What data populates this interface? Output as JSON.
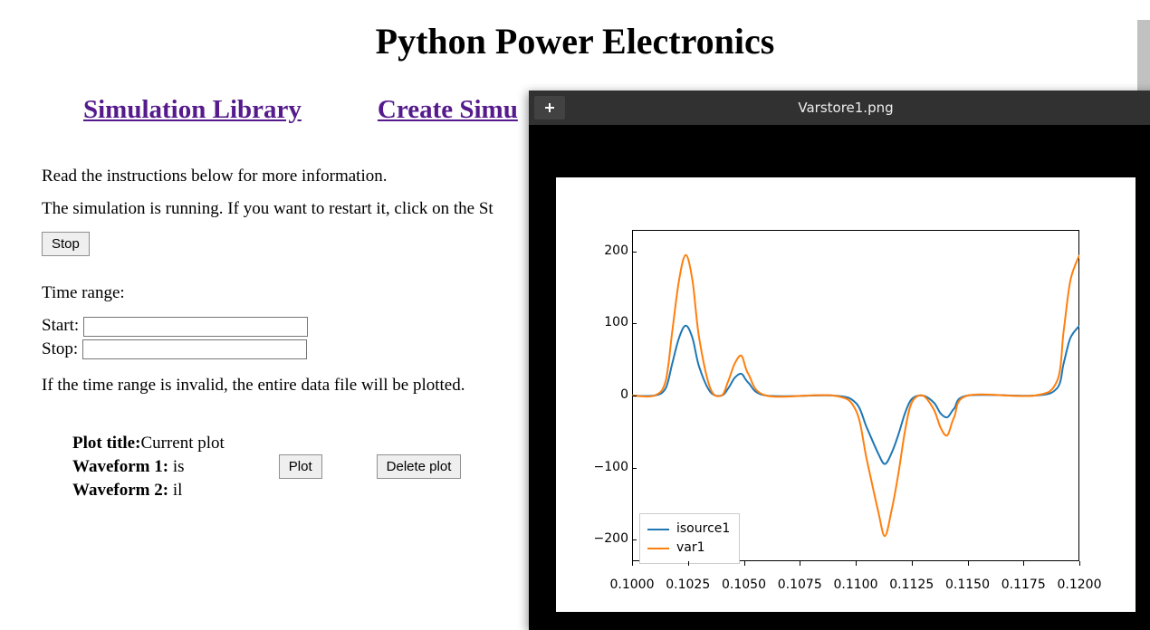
{
  "header": {
    "title": "Python Power Electronics"
  },
  "nav": {
    "link1": "Simulation Library",
    "link2": "Create Simu"
  },
  "instructions": {
    "line1": "Read the instructions below for more information.",
    "line2": "The simulation is running. If you want to restart it, click on the St"
  },
  "buttons": {
    "stop": "Stop",
    "plot": "Plot",
    "delete_plot": "Delete plot"
  },
  "time_range": {
    "header": "Time range:",
    "start_label": "Start: ",
    "stop_label": "Stop: ",
    "start_value": "",
    "stop_value": "",
    "invalid_note": "If the time range is invalid, the entire data file will be plotted."
  },
  "plot_info": {
    "title_label": "Plot title:",
    "title_value": "Current plot",
    "wf1_label": "Waveform 1: ",
    "wf1_value": "is",
    "wf2_label": "Waveform 2: ",
    "wf2_value": "il"
  },
  "viewer": {
    "filename": "Varstore1.png"
  },
  "chart_data": {
    "type": "line",
    "x_range": [
      0.1,
      0.12
    ],
    "x_ticks": [
      0.1,
      0.1025,
      0.105,
      0.1075,
      0.11,
      0.1125,
      0.115,
      0.1175,
      0.12
    ],
    "y_ticks": [
      -200,
      -100,
      0,
      100,
      200
    ],
    "ylim": [
      -230,
      230
    ],
    "series": [
      {
        "name": "isource1",
        "color": "#1f77b4",
        "x": [
          0.1,
          0.101,
          0.1015,
          0.1018,
          0.1021,
          0.1024,
          0.1027,
          0.103,
          0.1035,
          0.104,
          0.1043,
          0.1046,
          0.1049,
          0.1052,
          0.106,
          0.109,
          0.11,
          0.1105,
          0.111,
          0.1113,
          0.1116,
          0.1119,
          0.1122,
          0.1125,
          0.113,
          0.1135,
          0.1138,
          0.1141,
          0.1144,
          0.115,
          0.118,
          0.119,
          0.1193,
          0.1196,
          0.12
        ],
        "y": [
          0,
          0,
          10,
          45,
          80,
          97,
          80,
          40,
          5,
          0,
          10,
          25,
          30,
          18,
          0,
          0,
          -10,
          -45,
          -80,
          -95,
          -80,
          -55,
          -25,
          -5,
          0,
          -10,
          -25,
          -30,
          -18,
          0,
          0,
          10,
          45,
          80,
          97
        ]
      },
      {
        "name": "var1",
        "color": "#ff7f0e",
        "x": [
          0.1,
          0.101,
          0.1015,
          0.1018,
          0.1021,
          0.1024,
          0.1027,
          0.103,
          0.1035,
          0.104,
          0.1043,
          0.1046,
          0.1049,
          0.1052,
          0.106,
          0.109,
          0.11,
          0.1105,
          0.111,
          0.1113,
          0.1116,
          0.1119,
          0.1122,
          0.1125,
          0.113,
          0.1135,
          0.1138,
          0.1141,
          0.1144,
          0.115,
          0.118,
          0.119,
          0.1193,
          0.1196,
          0.12
        ],
        "y": [
          0,
          0,
          20,
          90,
          160,
          195,
          160,
          80,
          10,
          0,
          20,
          45,
          55,
          30,
          0,
          0,
          -20,
          -90,
          -160,
          -195,
          -160,
          -110,
          -50,
          -10,
          0,
          -20,
          -45,
          -55,
          -30,
          0,
          0,
          20,
          90,
          160,
          195
        ]
      }
    ]
  }
}
